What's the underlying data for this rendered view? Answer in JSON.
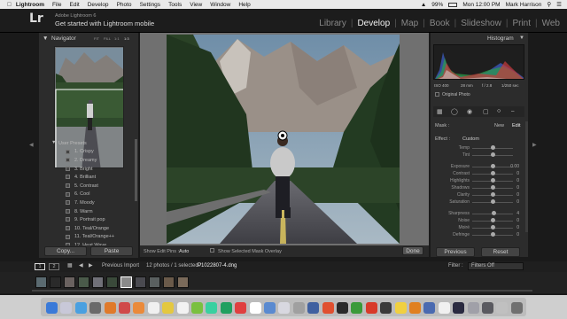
{
  "menubar": {
    "app": "Lightroom",
    "items": [
      "File",
      "Edit",
      "Develop",
      "Photo",
      "Settings",
      "Tools",
      "View",
      "Window",
      "Help"
    ],
    "battery": "99%",
    "clock": "Mon 12:00 PM",
    "user": "Mark Harrison"
  },
  "identity": {
    "logo": "Lr",
    "line1": "Adobe Lightroom 6",
    "line2": "Get started with Lightroom mobile",
    "modules": [
      "Library",
      "Develop",
      "Map",
      "Book",
      "Slideshow",
      "Print",
      "Web"
    ],
    "active_module": "Develop"
  },
  "left": {
    "navigator_title": "Navigator",
    "zoom_options": [
      "FIT",
      "FILL",
      "1:1",
      "1:3"
    ],
    "presets_group": "User Presets",
    "presets": [
      "1. Crispy",
      "2. Dreamy",
      "3. Bright",
      "4. Brilliant",
      "5. Contrast",
      "6. Cool",
      "7. Moody",
      "8. Warm",
      "9. Portrait pop",
      "10. Teal/Orange",
      "11. Teal/Orange++",
      "12. Heat Wave"
    ],
    "copy_label": "Copy...",
    "paste_label": "Paste"
  },
  "toolbar": {
    "show_edit_pins": "Show Edit Pins :",
    "edit_pins_value": "Auto",
    "show_mask": "Show Selected Mask Overlay",
    "done": "Done"
  },
  "right": {
    "histogram_title": "Histogram",
    "exif": [
      "ISO 400",
      "28 mm",
      "f / 2.8",
      "1/250 sec"
    ],
    "original_photo": "Original Photo",
    "mask_label": "Mask :",
    "new_label": "New",
    "edit_label": "Edit",
    "effect_label": "Effect :",
    "effect_value": "Custom",
    "sliders": [
      {
        "label": "Temp",
        "value": "",
        "pos": 0.5
      },
      {
        "label": "Tint",
        "value": "",
        "pos": 0.5
      },
      {
        "label": "Exposure",
        "value": "0.00",
        "pos": 0.5
      },
      {
        "label": "Contrast",
        "value": "0",
        "pos": 0.5
      },
      {
        "label": "Highlights",
        "value": "0",
        "pos": 0.5
      },
      {
        "label": "Shadows",
        "value": "0",
        "pos": 0.5
      },
      {
        "label": "Clarity",
        "value": "0",
        "pos": 0.5
      },
      {
        "label": "Saturation",
        "value": "0",
        "pos": 0.5
      },
      {
        "label": "Sharpness",
        "value": "4",
        "pos": 0.53
      },
      {
        "label": "Noise",
        "value": "0",
        "pos": 0.5
      },
      {
        "label": "Moiré",
        "value": "0",
        "pos": 0.5
      },
      {
        "label": "Defringe",
        "value": "0",
        "pos": 0.5
      }
    ],
    "previous_label": "Previous",
    "reset_label": "Reset"
  },
  "filmstrip": {
    "pages": [
      "1",
      "2"
    ],
    "source": "Previous Import",
    "count": "12 photos / 1 selected /",
    "filename": "P1022807-4.dng",
    "filter_label": "Filter :",
    "filter_value": "Filters Off"
  },
  "colors": {
    "panel": "#2c2c2c",
    "center_bg": "#707070",
    "sky": "#7d9bb3",
    "forest": "#2b4a2a",
    "road": "#4a4a4e"
  }
}
